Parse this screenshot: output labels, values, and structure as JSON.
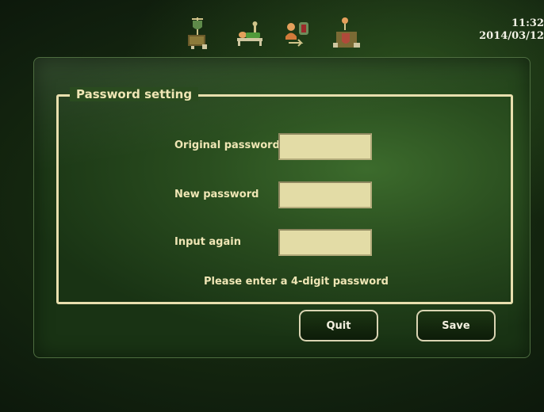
{
  "status": {
    "time": "11:32",
    "date": "2014/03/12"
  },
  "toolbar": {
    "icons": [
      "drip-stand-icon",
      "patient-bed-icon",
      "nurse-transfer-icon",
      "patient-drip-icon"
    ]
  },
  "colors": {
    "frame": "#e8dfae",
    "input_bg": "#e3dca6",
    "text": "#efe6b5"
  },
  "password_setting": {
    "title": "Password setting",
    "original_label": "Original password",
    "new_label": "New password",
    "again_label": "Input again",
    "original_value": "",
    "new_value": "",
    "again_value": "",
    "hint": "Please enter a 4-digit password"
  },
  "buttons": {
    "quit": "Quit",
    "save": "Save"
  }
}
